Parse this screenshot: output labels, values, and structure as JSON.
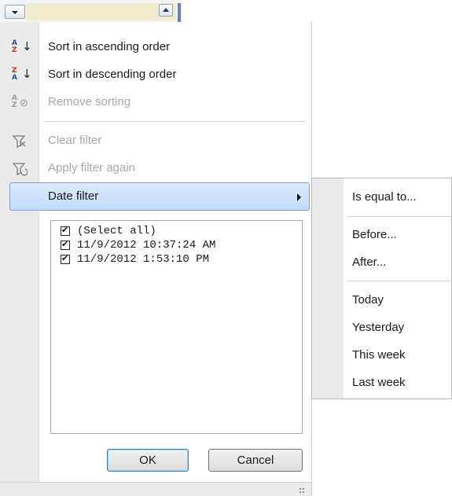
{
  "menu": {
    "sort_asc": "Sort in ascending order",
    "sort_desc": "Sort in descending order",
    "remove_sorting": "Remove sorting",
    "clear_filter": "Clear filter",
    "apply_filter_again": "Apply filter again",
    "date_filter": "Date filter"
  },
  "list": {
    "items": [
      {
        "label": "(Select all)",
        "checked": true
      },
      {
        "label": "11/9/2012 10:37:24 AM",
        "checked": true
      },
      {
        "label": "11/9/2012 1:53:10 PM",
        "checked": true
      }
    ]
  },
  "buttons": {
    "ok": "OK",
    "cancel": "Cancel"
  },
  "submenu": {
    "items": [
      "Is equal to...",
      "Before...",
      "After...",
      "Today",
      "Yesterday",
      "This week",
      "Last week"
    ]
  },
  "icons": {
    "sort_asc": "sort-ascending-icon",
    "sort_desc": "sort-descending-icon",
    "remove_sorting": "remove-sorting-icon",
    "clear_filter": "clear-filter-icon",
    "apply_filter": "apply-filter-icon",
    "checkbox": "checkmark-icon"
  }
}
